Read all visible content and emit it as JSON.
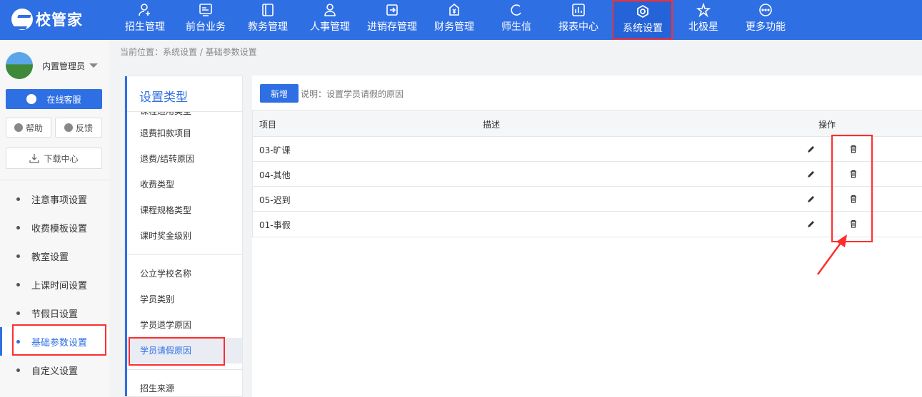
{
  "app": {
    "logo_text": "校管家"
  },
  "nav": [
    {
      "label": "招生管理",
      "icon": "person-add-icon"
    },
    {
      "label": "前台业务",
      "icon": "monitor-icon"
    },
    {
      "label": "教务管理",
      "icon": "book-icon"
    },
    {
      "label": "人事管理",
      "icon": "person-icon"
    },
    {
      "label": "进销存管理",
      "icon": "inbox-arrow-icon"
    },
    {
      "label": "财务管理",
      "icon": "money-bag-icon"
    },
    {
      "label": "师生信",
      "icon": "chat-icon"
    },
    {
      "label": "报表中心",
      "icon": "chart-icon"
    },
    {
      "label": "系统设置",
      "icon": "gear-icon",
      "active": true
    },
    {
      "label": "北极星",
      "icon": "star-icon"
    },
    {
      "label": "更多功能",
      "icon": "more-icon"
    }
  ],
  "user": {
    "name": "内置管理员"
  },
  "sidebar": {
    "service_label": "在线客服",
    "help_label": "帮助",
    "feedback_label": "反馈",
    "download_label": "下载中心",
    "items": [
      {
        "label": "注意事项设置"
      },
      {
        "label": "收费模板设置"
      },
      {
        "label": "教室设置"
      },
      {
        "label": "上课时间设置"
      },
      {
        "label": "节假日设置"
      },
      {
        "label": "基础参数设置",
        "active": true
      },
      {
        "label": "自定义设置"
      }
    ]
  },
  "breadcrumb": "当前位置：系统设置 / 基础参数设置",
  "categories": {
    "title": "设置类型",
    "cut_label": "课程适用类型",
    "group1": [
      "退费扣款项目",
      "退费/结转原因",
      "收费类型",
      "课程规格类型",
      "课时奖金级别"
    ],
    "group2": [
      "公立学校名称",
      "学员类别",
      "学员退学原因",
      "学员请假原因",
      "招生来源"
    ],
    "active": "学员请假原因"
  },
  "main": {
    "new_button": "新增",
    "hint": "说明：设置学员请假的原因",
    "columns": {
      "item": "项目",
      "desc": "描述",
      "ops": "操作"
    },
    "rows": [
      {
        "item": "03-旷课",
        "desc": ""
      },
      {
        "item": "04-其他",
        "desc": ""
      },
      {
        "item": "05-迟到",
        "desc": ""
      },
      {
        "item": "01-事假",
        "desc": ""
      }
    ]
  },
  "colors": {
    "primary": "#2f6fe4",
    "highlight": "#ff2d2d"
  }
}
